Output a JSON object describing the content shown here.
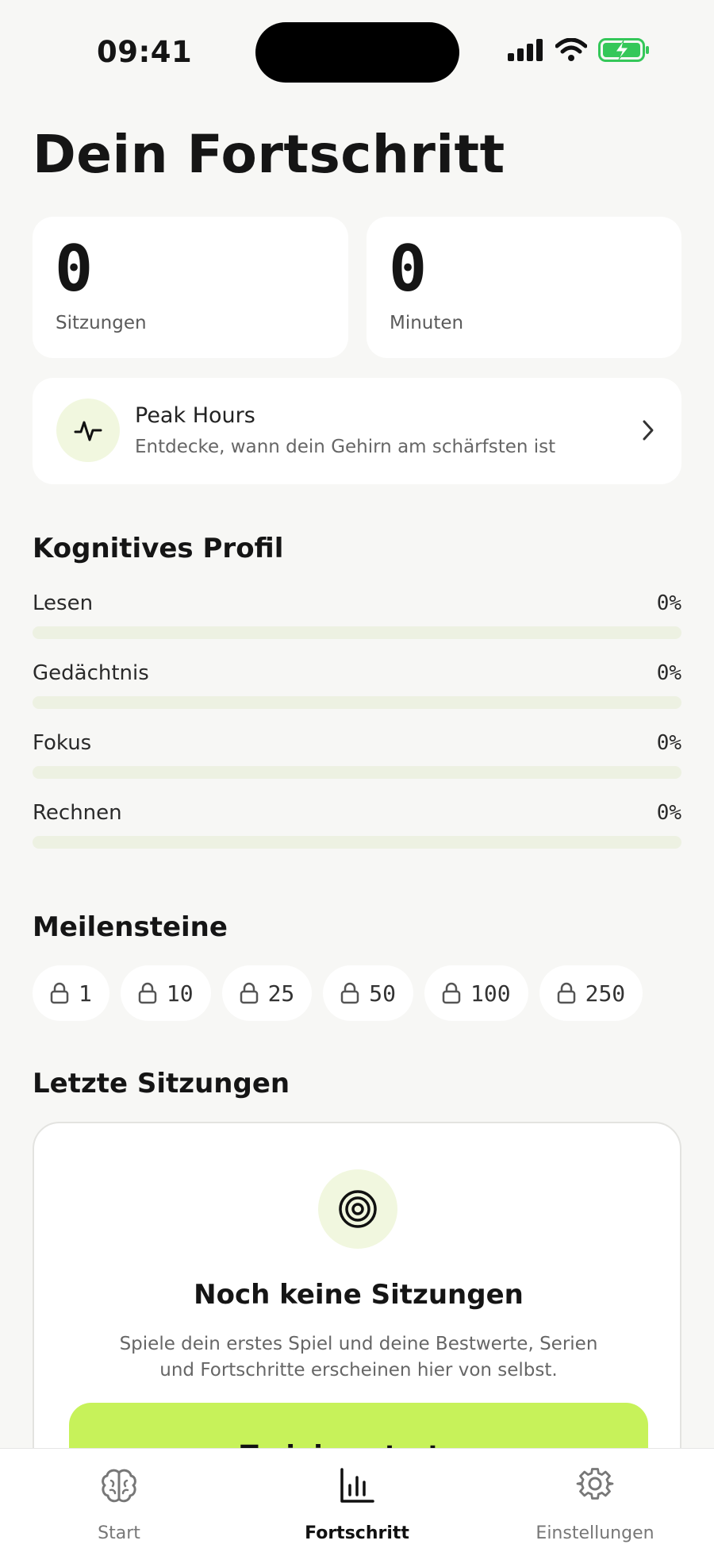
{
  "status_bar": {
    "time": "09:41"
  },
  "header": {
    "title": "Dein Fortschritt"
  },
  "stats": [
    {
      "value": "0",
      "label": "Sitzungen"
    },
    {
      "value": "0",
      "label": "Minuten"
    }
  ],
  "peak_hours": {
    "title": "Peak Hours",
    "subtitle": "Entdecke, wann dein Gehirn am schärfsten ist",
    "icon": "pulse-icon"
  },
  "cognitive_profile": {
    "title": "Kognitives Profil",
    "skills": [
      {
        "name": "Lesen",
        "percent_label": "0%",
        "percent": 0
      },
      {
        "name": "Gedächtnis",
        "percent_label": "0%",
        "percent": 0
      },
      {
        "name": "Fokus",
        "percent_label": "0%",
        "percent": 0
      },
      {
        "name": "Rechnen",
        "percent_label": "0%",
        "percent": 0
      }
    ]
  },
  "milestones": {
    "title": "Meilensteine",
    "items": [
      "1",
      "10",
      "25",
      "50",
      "100",
      "250"
    ],
    "icon": "lock-icon"
  },
  "recent_sessions": {
    "title": "Letzte Sitzungen",
    "empty_title": "Noch keine Sitzungen",
    "empty_text": "Spiele dein erstes Spiel und deine Bestwerte, Serien und Fortschritte erscheinen hier von selbst.",
    "cta_label": "Training starten",
    "icon": "target-icon"
  },
  "tab_bar": {
    "tabs": [
      {
        "label": "Start",
        "icon": "brain-icon",
        "active": false
      },
      {
        "label": "Fortschritt",
        "icon": "bar-chart-icon",
        "active": true
      },
      {
        "label": "Einstellungen",
        "icon": "gear-icon",
        "active": false
      }
    ]
  },
  "colors": {
    "accent": "#c7f25a",
    "accent_soft": "#f1f7df",
    "background": "#f7f7f5",
    "track": "#edf1e2",
    "battery": "#34c759"
  }
}
